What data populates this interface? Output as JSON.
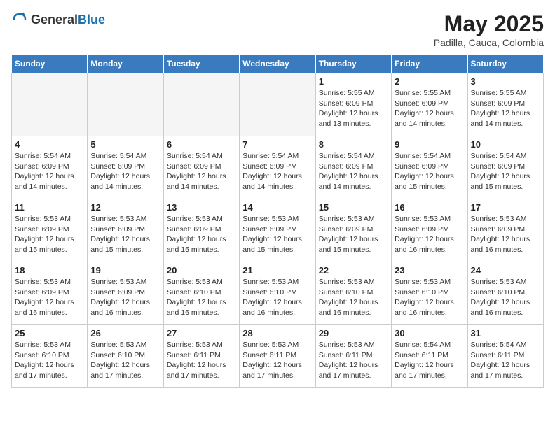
{
  "header": {
    "logo_general": "General",
    "logo_blue": "Blue",
    "title": "May 2025",
    "subtitle": "Padilla, Cauca, Colombia"
  },
  "weekdays": [
    "Sunday",
    "Monday",
    "Tuesday",
    "Wednesday",
    "Thursday",
    "Friday",
    "Saturday"
  ],
  "weeks": [
    [
      {
        "day": "",
        "empty": true
      },
      {
        "day": "",
        "empty": true
      },
      {
        "day": "",
        "empty": true
      },
      {
        "day": "",
        "empty": true
      },
      {
        "day": "1",
        "sunrise": "5:55 AM",
        "sunset": "6:09 PM",
        "daylight": "12 hours and 13 minutes."
      },
      {
        "day": "2",
        "sunrise": "5:55 AM",
        "sunset": "6:09 PM",
        "daylight": "12 hours and 14 minutes."
      },
      {
        "day": "3",
        "sunrise": "5:55 AM",
        "sunset": "6:09 PM",
        "daylight": "12 hours and 14 minutes."
      }
    ],
    [
      {
        "day": "4",
        "sunrise": "5:54 AM",
        "sunset": "6:09 PM",
        "daylight": "12 hours and 14 minutes."
      },
      {
        "day": "5",
        "sunrise": "5:54 AM",
        "sunset": "6:09 PM",
        "daylight": "12 hours and 14 minutes."
      },
      {
        "day": "6",
        "sunrise": "5:54 AM",
        "sunset": "6:09 PM",
        "daylight": "12 hours and 14 minutes."
      },
      {
        "day": "7",
        "sunrise": "5:54 AM",
        "sunset": "6:09 PM",
        "daylight": "12 hours and 14 minutes."
      },
      {
        "day": "8",
        "sunrise": "5:54 AM",
        "sunset": "6:09 PM",
        "daylight": "12 hours and 14 minutes."
      },
      {
        "day": "9",
        "sunrise": "5:54 AM",
        "sunset": "6:09 PM",
        "daylight": "12 hours and 15 minutes."
      },
      {
        "day": "10",
        "sunrise": "5:54 AM",
        "sunset": "6:09 PM",
        "daylight": "12 hours and 15 minutes."
      }
    ],
    [
      {
        "day": "11",
        "sunrise": "5:53 AM",
        "sunset": "6:09 PM",
        "daylight": "12 hours and 15 minutes."
      },
      {
        "day": "12",
        "sunrise": "5:53 AM",
        "sunset": "6:09 PM",
        "daylight": "12 hours and 15 minutes."
      },
      {
        "day": "13",
        "sunrise": "5:53 AM",
        "sunset": "6:09 PM",
        "daylight": "12 hours and 15 minutes."
      },
      {
        "day": "14",
        "sunrise": "5:53 AM",
        "sunset": "6:09 PM",
        "daylight": "12 hours and 15 minutes."
      },
      {
        "day": "15",
        "sunrise": "5:53 AM",
        "sunset": "6:09 PM",
        "daylight": "12 hours and 15 minutes."
      },
      {
        "day": "16",
        "sunrise": "5:53 AM",
        "sunset": "6:09 PM",
        "daylight": "12 hours and 16 minutes."
      },
      {
        "day": "17",
        "sunrise": "5:53 AM",
        "sunset": "6:09 PM",
        "daylight": "12 hours and 16 minutes."
      }
    ],
    [
      {
        "day": "18",
        "sunrise": "5:53 AM",
        "sunset": "6:09 PM",
        "daylight": "12 hours and 16 minutes."
      },
      {
        "day": "19",
        "sunrise": "5:53 AM",
        "sunset": "6:09 PM",
        "daylight": "12 hours and 16 minutes."
      },
      {
        "day": "20",
        "sunrise": "5:53 AM",
        "sunset": "6:10 PM",
        "daylight": "12 hours and 16 minutes."
      },
      {
        "day": "21",
        "sunrise": "5:53 AM",
        "sunset": "6:10 PM",
        "daylight": "12 hours and 16 minutes."
      },
      {
        "day": "22",
        "sunrise": "5:53 AM",
        "sunset": "6:10 PM",
        "daylight": "12 hours and 16 minutes."
      },
      {
        "day": "23",
        "sunrise": "5:53 AM",
        "sunset": "6:10 PM",
        "daylight": "12 hours and 16 minutes."
      },
      {
        "day": "24",
        "sunrise": "5:53 AM",
        "sunset": "6:10 PM",
        "daylight": "12 hours and 16 minutes."
      }
    ],
    [
      {
        "day": "25",
        "sunrise": "5:53 AM",
        "sunset": "6:10 PM",
        "daylight": "12 hours and 17 minutes."
      },
      {
        "day": "26",
        "sunrise": "5:53 AM",
        "sunset": "6:10 PM",
        "daylight": "12 hours and 17 minutes."
      },
      {
        "day": "27",
        "sunrise": "5:53 AM",
        "sunset": "6:11 PM",
        "daylight": "12 hours and 17 minutes."
      },
      {
        "day": "28",
        "sunrise": "5:53 AM",
        "sunset": "6:11 PM",
        "daylight": "12 hours and 17 minutes."
      },
      {
        "day": "29",
        "sunrise": "5:53 AM",
        "sunset": "6:11 PM",
        "daylight": "12 hours and 17 minutes."
      },
      {
        "day": "30",
        "sunrise": "5:54 AM",
        "sunset": "6:11 PM",
        "daylight": "12 hours and 17 minutes."
      },
      {
        "day": "31",
        "sunrise": "5:54 AM",
        "sunset": "6:11 PM",
        "daylight": "12 hours and 17 minutes."
      }
    ]
  ]
}
